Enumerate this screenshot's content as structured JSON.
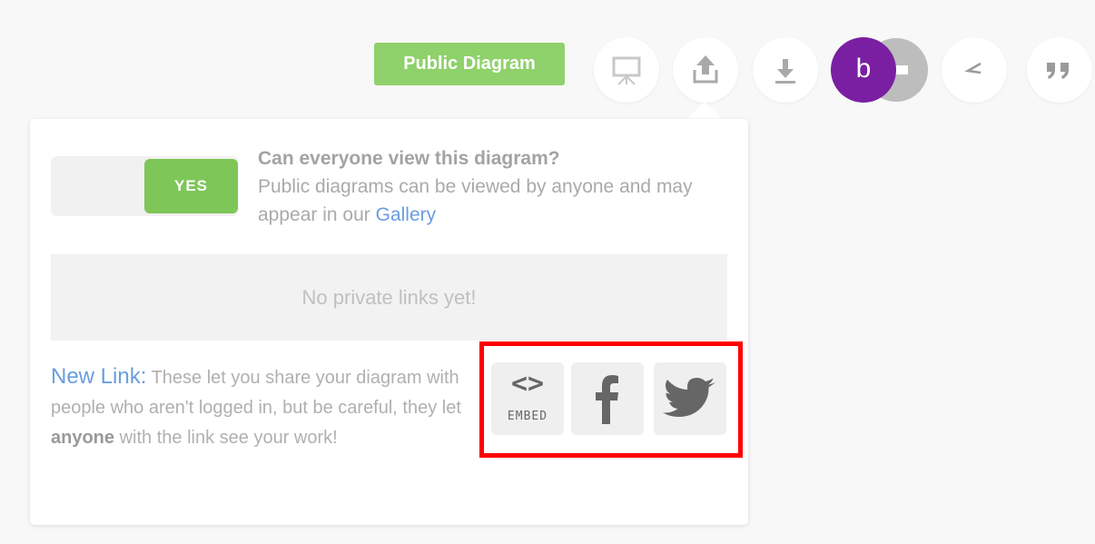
{
  "toolbar": {
    "public_badge": "Public Diagram",
    "icons": [
      "presentation-icon",
      "share-upload-icon",
      "download-icon",
      "collaborators-icon",
      "comment-mark-icon",
      "quote-icon"
    ],
    "avatar_letter": "b",
    "avatar_color": "#7a1fa2"
  },
  "popover": {
    "toggle_label": "YES",
    "question": "Can everyone view this diagram?",
    "description": "Public diagrams can be viewed by anyone and may appear in our",
    "gallery_link": "Gallery",
    "empty_state": "No private links yet!",
    "new_link": {
      "label": "New Link:",
      "text_before": "These let you share your diagram with people who aren't logged in, but be careful, they let",
      "emphasis": "anyone",
      "text_after": "with the link see your work!"
    },
    "share_buttons": {
      "embed_glyph": "<>",
      "embed_label": "EMBED",
      "facebook_icon": "facebook-icon",
      "twitter_icon": "twitter-icon"
    }
  },
  "colors": {
    "accent_green": "#8fd16b",
    "toggle_green": "#7fc659",
    "link_blue": "#6a9de0",
    "highlight_red": "#ff0000"
  }
}
